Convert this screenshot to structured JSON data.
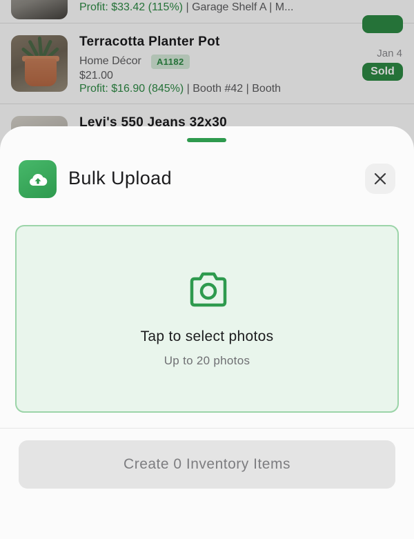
{
  "list": {
    "items": [
      {
        "title": "",
        "category": "",
        "sku": "",
        "price": "",
        "profit": "Profit: $33.42 (115%)",
        "location": " | Garage Shelf A | M...",
        "date": "",
        "status": ""
      },
      {
        "title": "Terracotta Planter Pot",
        "category": "Home Décor",
        "sku": "A1182",
        "price": "$21.00",
        "profit": "Profit: $16.90 (845%)",
        "location": " | Booth #42 | Booth",
        "date": "Jan 4",
        "status": "Sold"
      },
      {
        "title": "Levi's 550 Jeans 32x30"
      }
    ]
  },
  "sheet": {
    "title": "Bulk Upload",
    "icon": "cloud-upload-icon",
    "close_icon": "close-icon",
    "dropzone": {
      "icon": "camera-icon",
      "title": "Tap to select photos",
      "subtitle": "Up to 20 photos"
    },
    "create_button": "Create 0 Inventory Items"
  },
  "colors": {
    "accent": "#2e9a4e",
    "profit": "#2e8b45",
    "dropzone_bg": "#e9f5ec",
    "dropzone_border": "#9bd4a8",
    "disabled_button": "#e4e4e4"
  }
}
